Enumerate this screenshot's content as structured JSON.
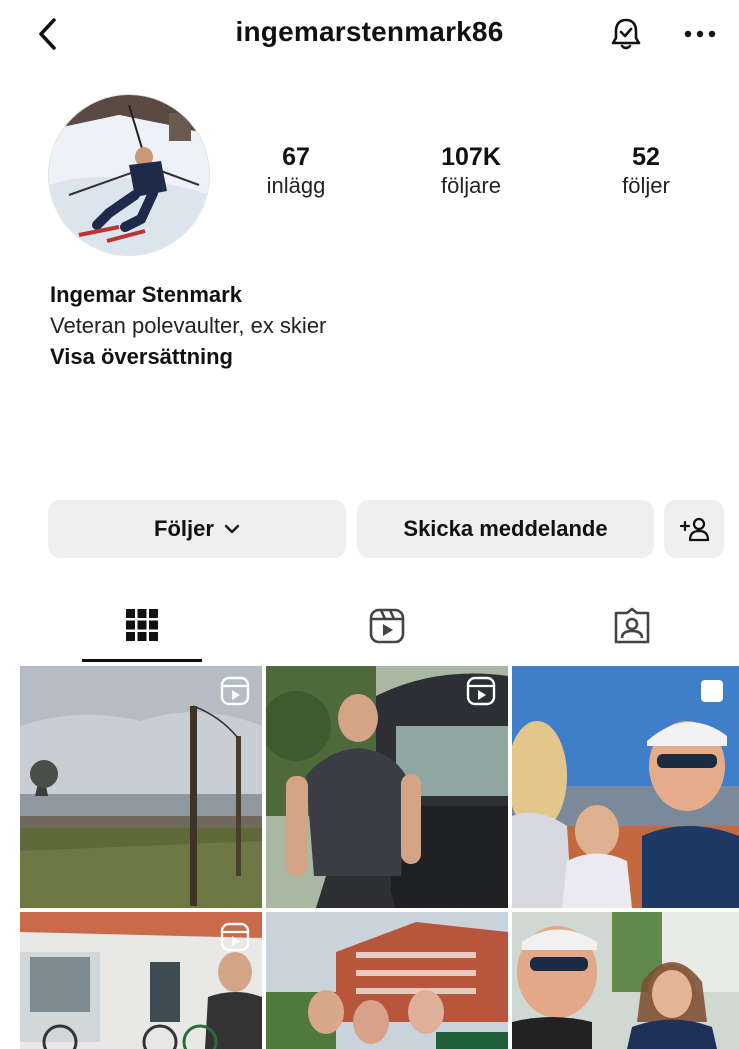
{
  "header": {
    "username": "ingemarstenmark86",
    "back_icon": "chevron-left-icon",
    "bell_icon": "bell-icon",
    "more_icon": "more-horizontal-icon"
  },
  "profile": {
    "avatar_alt": "profile-photo",
    "stats": {
      "posts": {
        "value": "67",
        "label": "inlägg"
      },
      "followers": {
        "value": "107K",
        "label": "följare"
      },
      "following": {
        "value": "52",
        "label": "följer"
      }
    },
    "name": "Ingemar Stenmark",
    "bio": "Veteran polevaulter, ex skier",
    "translate": "Visa översättning"
  },
  "actions": {
    "follow_label": "Följer",
    "message_label": "Skicka meddelande",
    "add_user_icon": "add-user-icon"
  },
  "tabs": [
    {
      "name": "grid",
      "icon": "grid-icon",
      "active": true
    },
    {
      "name": "reels",
      "icon": "reels-icon",
      "active": false
    },
    {
      "name": "tagged",
      "icon": "tagged-icon",
      "active": false
    }
  ],
  "posts": [
    {
      "type": "reel",
      "subject": "lake-with-pole"
    },
    {
      "type": "reel",
      "subject": "man-at-car-trunk"
    },
    {
      "type": "multi",
      "subject": "selfie-at-tennis"
    },
    {
      "type": "reel",
      "subject": "man-by-white-house"
    },
    {
      "type": "photo",
      "subject": "group-in-front-of-building"
    },
    {
      "type": "photo",
      "subject": "selfie-with-girl"
    }
  ],
  "colors": {
    "text": "#111111",
    "button_bg": "#efefef",
    "active_tab": "#111111"
  }
}
